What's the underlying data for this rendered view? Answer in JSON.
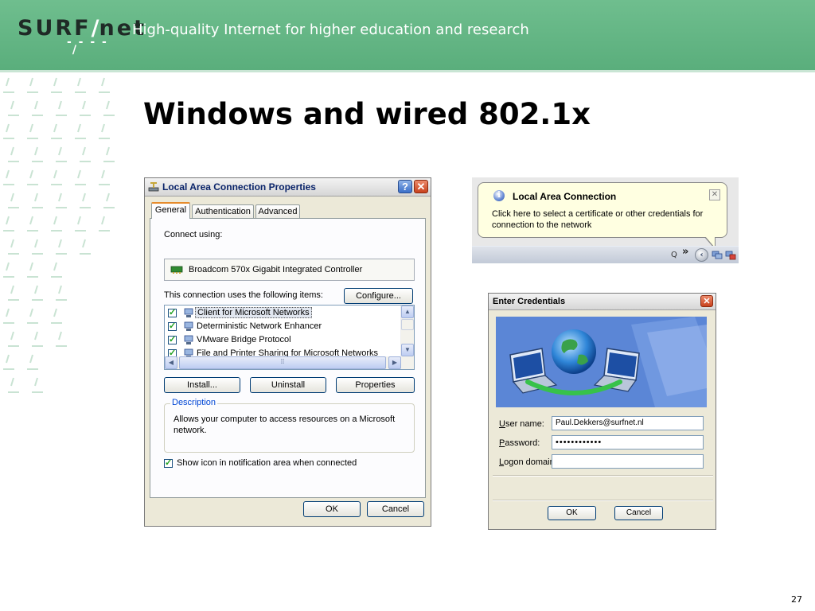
{
  "header": {
    "logo_left": "SURF",
    "logo_slash": "/",
    "logo_right": "net",
    "tagline": "High-quality Internet for higher education and research"
  },
  "slide": {
    "title": "Windows and wired 802.1x",
    "page_number": "27"
  },
  "lan_dialog": {
    "title": "Local Area Connection Properties",
    "tabs": [
      {
        "label": "General",
        "active": true
      },
      {
        "label": "Authentication",
        "active": false
      },
      {
        "label": "Advanced",
        "active": false
      }
    ],
    "connect_using_label": "Connect using:",
    "adapter": "Broadcom 570x Gigabit Integrated Controller",
    "configure_button": "Configure...",
    "items_label": "This connection uses the following items:",
    "items": [
      {
        "label": "Client for Microsoft Networks",
        "checked": true,
        "selected": true
      },
      {
        "label": "Deterministic Network Enhancer",
        "checked": true,
        "selected": false
      },
      {
        "label": "VMware Bridge Protocol",
        "checked": true,
        "selected": false
      },
      {
        "label": "File and Printer Sharing for Microsoft Networks",
        "checked": true,
        "selected": false
      }
    ],
    "install_button": "Install...",
    "uninstall_button": "Uninstall",
    "properties_button": "Properties",
    "description_legend": "Description",
    "description_text": "Allows your computer to access resources on a Microsoft network.",
    "show_icon_label": "Show icon in notification area when connected",
    "ok_button": "OK",
    "cancel_button": "Cancel"
  },
  "notification": {
    "title": "Local Area Connection",
    "text": "Click here to select a certificate or other credentials for connection to the network",
    "tray_text": "Q",
    "tray_chevron": "»"
  },
  "credentials_dialog": {
    "title": "Enter Credentials",
    "username_label": "User name:",
    "username_value": "Paul.Dekkers@surfnet.nl",
    "password_label": "Password:",
    "password_value": "••••••••••••",
    "domain_label": "Logon domain:",
    "domain_value": "",
    "ok_button": "OK",
    "cancel_button": "Cancel"
  },
  "colors": {
    "header_green": "#5aae7c",
    "xp_face": "#ece9d8",
    "balloon_yellow": "#ffffe1",
    "close_red": "#c8421d"
  }
}
